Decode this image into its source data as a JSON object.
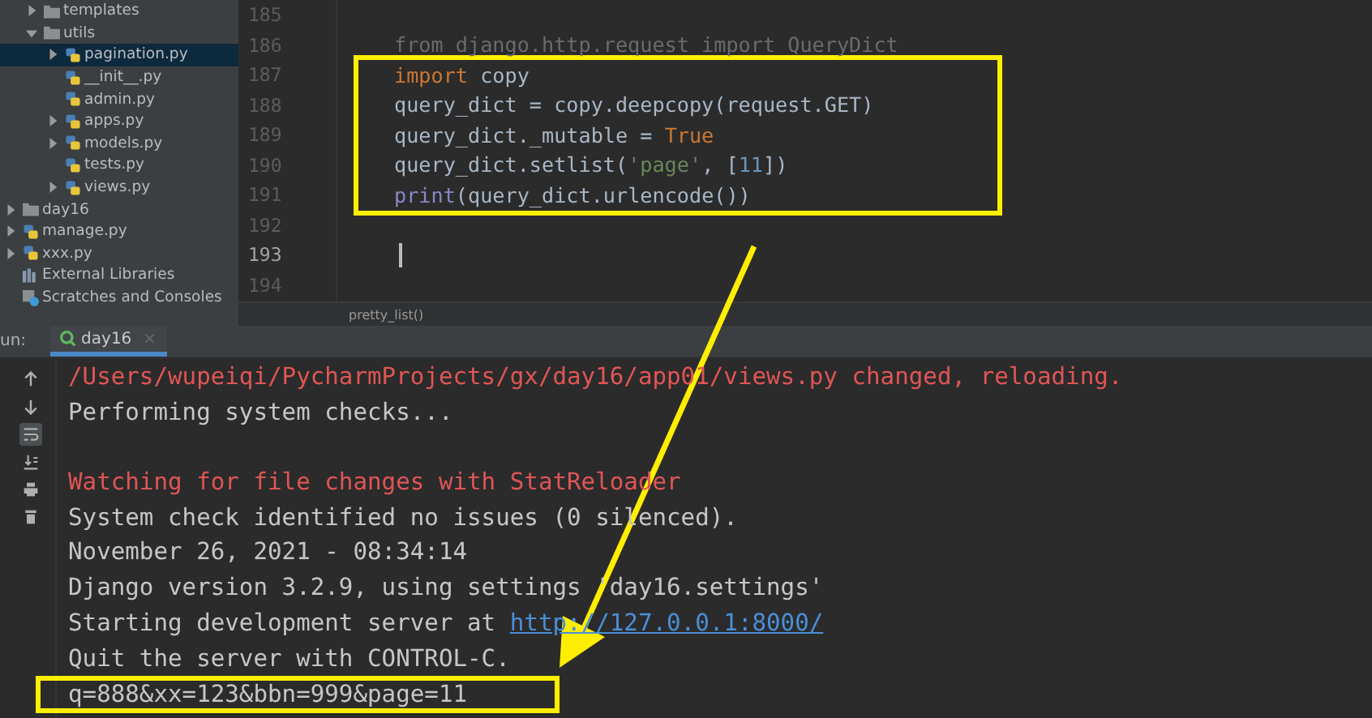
{
  "project_tree": [
    {
      "children": [
        {
          "label": "templates",
          "kind": "folder",
          "expanded": false,
          "selected": false
        },
        {
          "label": "utils",
          "kind": "folder",
          "expanded": true,
          "selected": false,
          "children": [
            {
              "label": "pagination.py",
              "kind": "python",
              "expanded": false,
              "selected": true
            },
            {
              "label": "__init__.py",
              "kind": "python",
              "selected": false
            },
            {
              "label": "admin.py",
              "kind": "python",
              "selected": false
            },
            {
              "label": "apps.py",
              "kind": "python",
              "expanded": false,
              "selected": false
            },
            {
              "label": "models.py",
              "kind": "python",
              "expanded": false,
              "selected": false
            },
            {
              "label": "tests.py",
              "kind": "python",
              "selected": false
            },
            {
              "label": "views.py",
              "kind": "python",
              "expanded": false,
              "selected": false
            }
          ]
        }
      ]
    },
    {
      "label": "day16",
      "kind": "folder",
      "expanded": false,
      "selected": false
    },
    {
      "label": "manage.py",
      "kind": "python",
      "expanded": false,
      "selected": false
    },
    {
      "label": "xxx.py",
      "kind": "python",
      "expanded": false,
      "selected": false
    },
    {
      "label": "External Libraries",
      "kind": "library",
      "selected": false
    },
    {
      "label": "Scratches and Consoles",
      "kind": "scratches",
      "selected": false
    }
  ],
  "editor": {
    "lines": [
      {
        "number": "185",
        "current": false,
        "boxed": false
      },
      {
        "number": "186",
        "current": false,
        "boxed": false,
        "tokens": [
          {
            "kind": "unused",
            "text": "from django.http.request import QueryDict"
          }
        ]
      },
      {
        "number": "187",
        "current": false,
        "boxed": true,
        "tokens": [
          {
            "kind": "keyword",
            "text": "import"
          },
          {
            "kind": "plain",
            "text": " copy"
          }
        ]
      },
      {
        "number": "188",
        "current": false,
        "boxed": true,
        "tokens": [
          {
            "kind": "plain",
            "text": "query_dict = copy.deepcopy(request.GET)"
          }
        ]
      },
      {
        "number": "189",
        "current": false,
        "boxed": true,
        "tokens": [
          {
            "kind": "plain",
            "text": "query_dict._mutable = "
          },
          {
            "kind": "keyword",
            "text": "True"
          }
        ]
      },
      {
        "number": "190",
        "current": false,
        "boxed": true,
        "tokens": [
          {
            "kind": "plain",
            "text": "query_dict.setlist("
          },
          {
            "kind": "string",
            "text": "'page'"
          },
          {
            "kind": "plain",
            "text": ", ["
          },
          {
            "kind": "number",
            "text": "11"
          },
          {
            "kind": "plain",
            "text": "])"
          }
        ]
      },
      {
        "number": "191",
        "current": false,
        "boxed": true,
        "tokens": [
          {
            "kind": "builtin",
            "text": "print"
          },
          {
            "kind": "plain",
            "text": "(query_dict.urlencode())"
          }
        ]
      },
      {
        "number": "192",
        "current": false,
        "boxed": false
      },
      {
        "number": "193",
        "current": true,
        "boxed": false
      },
      {
        "number": "194",
        "current": false,
        "boxed": false
      }
    ],
    "breadcrumb": "pretty_list()"
  },
  "run_panel": {
    "label": "un:",
    "tabs": [
      {
        "label": "day16",
        "selected": true,
        "close": "×"
      }
    ],
    "tools": [
      {
        "kind": "up",
        "selected": false
      },
      {
        "kind": "down",
        "selected": false
      },
      {
        "kind": "wrap",
        "selected": true
      },
      {
        "kind": "sort",
        "selected": false
      },
      {
        "kind": "print",
        "selected": false
      },
      {
        "kind": "trash",
        "selected": false
      }
    ],
    "console": [
      {
        "kind": "error",
        "boxed": false,
        "text": "/Users/wupeiqi/PycharmProjects/gx/day16/app01/views.py changed, reloading."
      },
      {
        "kind": "normal",
        "boxed": false,
        "text": "Performing system checks..."
      },
      {
        "kind": "blank",
        "boxed": false
      },
      {
        "kind": "error",
        "boxed": false,
        "text": "Watching for file changes with StatReloader"
      },
      {
        "kind": "normal",
        "boxed": false,
        "text": "System check identified no issues (0 silenced)."
      },
      {
        "kind": "normal",
        "boxed": false,
        "text": "November 26, 2021 - 08:34:14"
      },
      {
        "kind": "normal",
        "boxed": false,
        "text": "Django version 3.2.9, using settings 'day16.settings'"
      },
      {
        "kind": "link",
        "boxed": false,
        "text": "Starting development server at ",
        "link": "http://127.0.0.1:8000/"
      },
      {
        "kind": "normal",
        "boxed": false,
        "text": "Quit the server with CONTROL-C."
      },
      {
        "kind": "normal",
        "boxed": true,
        "text": "q=888&xx=123&bbn=999&page=11"
      }
    ]
  },
  "annotation": {
    "arrow": true
  }
}
